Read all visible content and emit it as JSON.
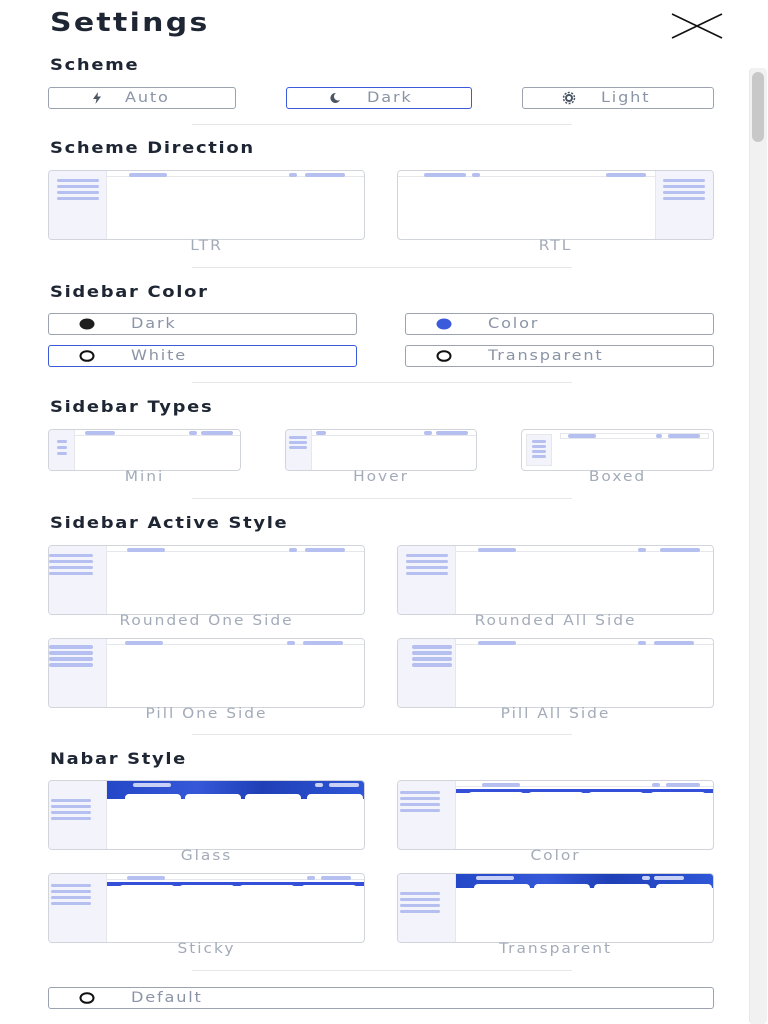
{
  "header": {
    "title": "Settings",
    "close_icon": "close-icon"
  },
  "scheme": {
    "heading": "Scheme",
    "options": [
      {
        "label": "Auto",
        "icon": "bolt-icon"
      },
      {
        "label": "Dark",
        "icon": "moon-icon"
      },
      {
        "label": "Light",
        "icon": "sun-icon"
      }
    ],
    "selected": "Dark"
  },
  "scheme_direction": {
    "heading": "Scheme Direction",
    "options": [
      {
        "label": "LTR"
      },
      {
        "label": "RTL"
      }
    ]
  },
  "sidebar_color": {
    "heading": "Sidebar Color",
    "options": [
      {
        "label": "Dark",
        "swatch": "#1e1e1e"
      },
      {
        "label": "Color",
        "swatch": "#3b5bdb"
      },
      {
        "label": "White",
        "swatch": "#ffffff"
      },
      {
        "label": "Transparent",
        "swatch": "transparent"
      }
    ],
    "selected": "White"
  },
  "sidebar_types": {
    "heading": "Sidebar Types",
    "options": [
      {
        "label": "Mini"
      },
      {
        "label": "Hover"
      },
      {
        "label": "Boxed"
      }
    ]
  },
  "sidebar_active_style": {
    "heading": "Sidebar Active Style",
    "options": [
      {
        "label": "Rounded One Side"
      },
      {
        "label": "Rounded All Side"
      },
      {
        "label": "Pill One Side"
      },
      {
        "label": "Pill All Side"
      }
    ]
  },
  "navbar_style": {
    "heading": "Nabar Style",
    "options": [
      {
        "label": "Glass"
      },
      {
        "label": "Color"
      },
      {
        "label": "Sticky"
      },
      {
        "label": "Transparent"
      }
    ]
  },
  "footer_option": {
    "label": "Default"
  },
  "colors": {
    "accent": "#3b5bdb",
    "border": "#9ca3af",
    "muted_text": "#8a94a6",
    "thumb_bar": "#b5bff0"
  }
}
